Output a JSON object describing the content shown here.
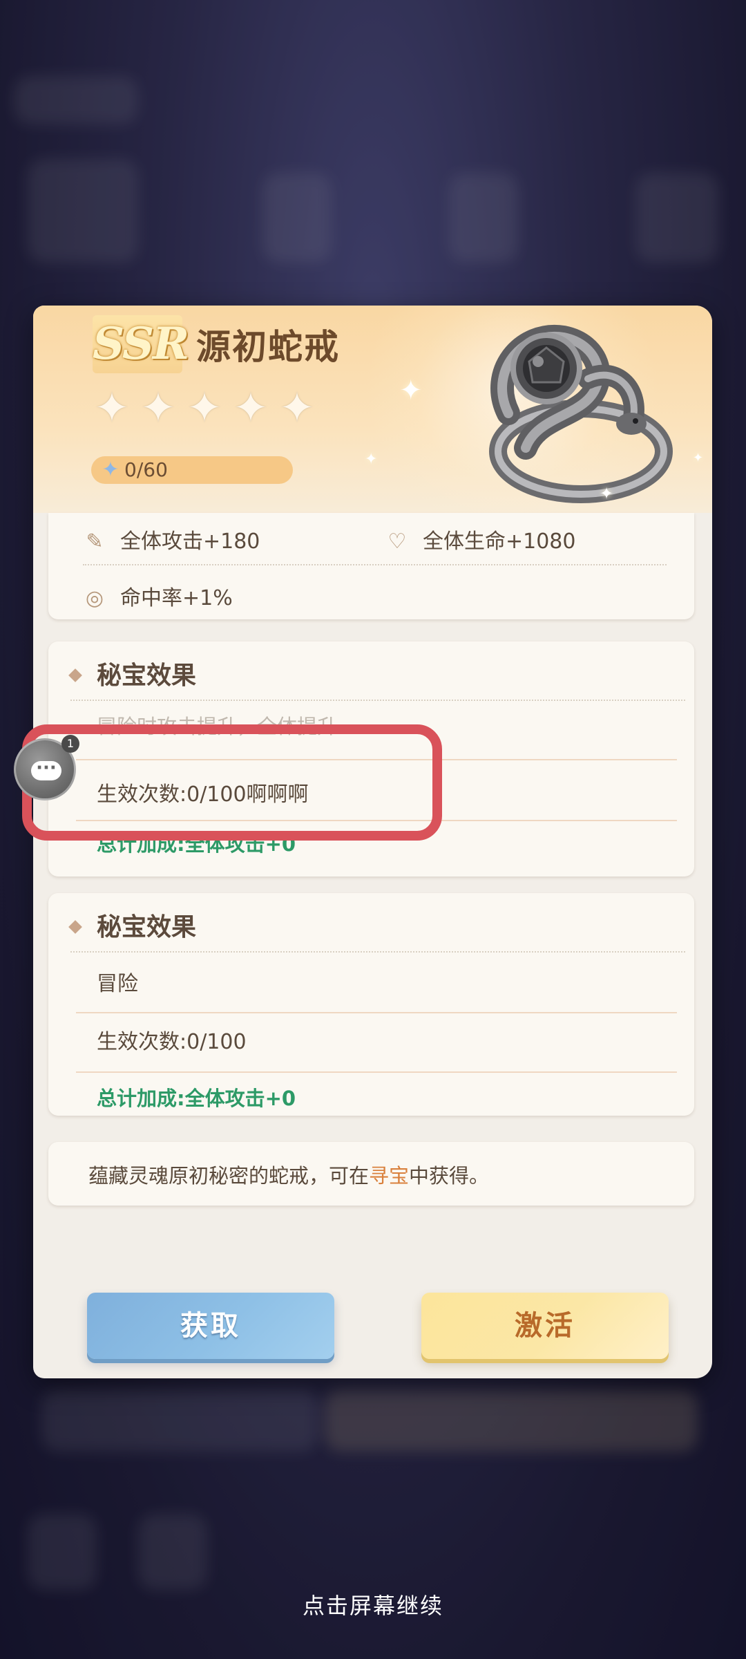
{
  "item": {
    "rarity": "SSR",
    "name": "源初蛇戒",
    "stars": [
      "✦",
      "✦",
      "✦",
      "✦",
      "✦"
    ],
    "fragments": "0/60"
  },
  "stats": [
    {
      "icon": "sword-icon",
      "label": "全体攻击+180"
    },
    {
      "icon": "heart-icon",
      "label": "全体生命+1080"
    },
    {
      "icon": "eye-icon",
      "label": "命中率+1%"
    }
  ],
  "effects": [
    {
      "title": "秘宝效果",
      "hidden_line": "冒险时攻击提升，全体提升",
      "count": "生效次数:0/100啊啊啊",
      "total": "总计加成:全体攻击+0"
    },
    {
      "title": "秘宝效果",
      "line": "冒险",
      "count": "生效次数:0/100",
      "total": "总计加成:全体攻击+0"
    }
  ],
  "description": {
    "prefix": "蕴藏灵魂原初秘密的蛇戒，可在",
    "link": "寻宝",
    "suffix": "中获得。"
  },
  "buttons": {
    "get": "获取",
    "activate": "激活"
  },
  "chat_bubble_badge": "1",
  "footer": "点击屏幕继续",
  "colors": {
    "highlight": "#d9525a",
    "green": "#2d9a67",
    "link": "#d9803c"
  }
}
